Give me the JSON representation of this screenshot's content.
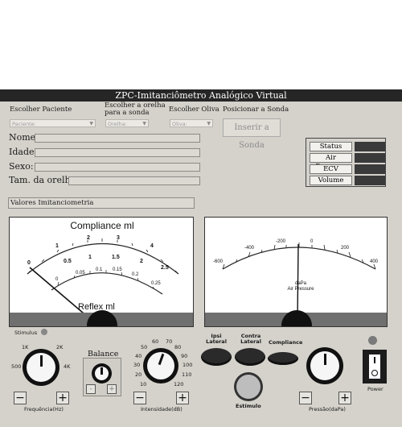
{
  "window": {
    "title": "ZPC-Imitanciômetro Analógico Virtual"
  },
  "top": {
    "escolher_paciente": "Escolher Paciente",
    "escolher_orelha": "Escolher a orelha para a sonda",
    "escolher_oliva": "Escolher Oliva",
    "posicionar_sonda": "Posicionar a Sonda",
    "paciente_placeholder": "Paciente:",
    "orelha_placeholder": "Orelha:",
    "oliva_placeholder": "Oliva:",
    "inserir_sonda": "Inserir a Sonda"
  },
  "fields": {
    "nome": "Nome:",
    "idade": "Idade:",
    "sexo": "Sexo:",
    "tam_orelha": "Tam. da orelha:",
    "valores": "Valores Imitanciometria"
  },
  "status_panel": {
    "items": [
      "Status",
      "Air Pressure",
      "ECV",
      "Volume"
    ]
  },
  "compliance_meter": {
    "title": "Compliance  ml",
    "bottom_label": "Reflex   ml",
    "outer_scale": [
      "0",
      "1",
      "2",
      "3",
      "4"
    ],
    "middle_scale": [
      "0.5",
      "1",
      "1.5",
      "2",
      "2.5"
    ],
    "inner_scale": [
      "0",
      "0.05",
      "0.1",
      "0.15",
      "0.2",
      "0.25"
    ],
    "needle_value": 0
  },
  "pressure_meter": {
    "scale": [
      "-600",
      "-400",
      "-200",
      "0",
      "200",
      "400"
    ],
    "center_label_1": "daPa",
    "center_label_2": "Air Pressure",
    "needle_value": -30
  },
  "controls": {
    "stimulus": "Stimulus",
    "freq_ticks": {
      "500": "500",
      "1k": "1K",
      "2k": "2K",
      "4k": "4K"
    },
    "freq_label": "Frequência(Hz)",
    "balance": "Balance",
    "intensity_ticks": {
      "t10": "10",
      "t20": "20",
      "t30": "30",
      "t40": "40",
      "t50": "50",
      "t60": "60",
      "t70": "70",
      "t80": "80",
      "t90": "90",
      "t100": "100",
      "t110": "110",
      "t120": "120"
    },
    "intensity_label": "Intensidade(dB)",
    "ipsi": "Ipsi Lateral",
    "contra": "Contra Lateral",
    "compliance": "Compliance",
    "estimulo": "Estímulo",
    "pressao": "Pressão(daPa)",
    "power": "Power",
    "minus": "−",
    "plus": "+",
    "bal_minus": "-",
    "bal_plus": "+"
  }
}
